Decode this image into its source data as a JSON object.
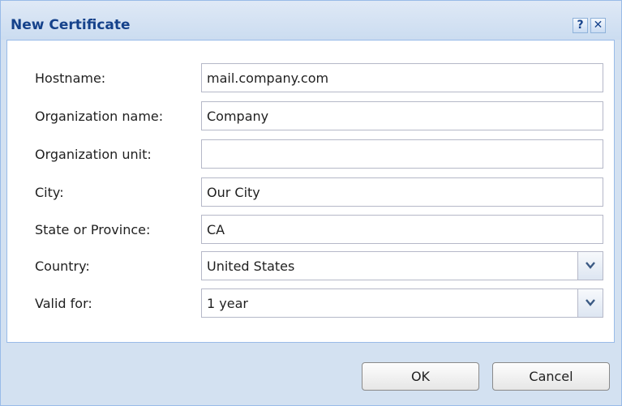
{
  "dialog": {
    "title": "New Certificate",
    "help_label": "?",
    "close_label": "✕"
  },
  "form": {
    "hostname": {
      "label": "Hostname:",
      "value": "mail.company.com"
    },
    "organization_name": {
      "label": "Organization name:",
      "value": "Company"
    },
    "organization_unit": {
      "label": "Organization unit:",
      "value": ""
    },
    "city": {
      "label": "City:",
      "value": "Our City"
    },
    "state": {
      "label": "State or Province:",
      "value": "CA"
    },
    "country": {
      "label": "Country:",
      "selected": "United States"
    },
    "valid_for": {
      "label": "Valid for:",
      "selected": "1 year"
    }
  },
  "buttons": {
    "ok": "OK",
    "cancel": "Cancel"
  },
  "colors": {
    "title_text": "#15428b",
    "frame_background": "#d3e1f1",
    "border": "#99bbe8"
  },
  "icons": {
    "help": "help-icon",
    "close": "close-icon",
    "dropdown": "chevron-down-icon"
  }
}
